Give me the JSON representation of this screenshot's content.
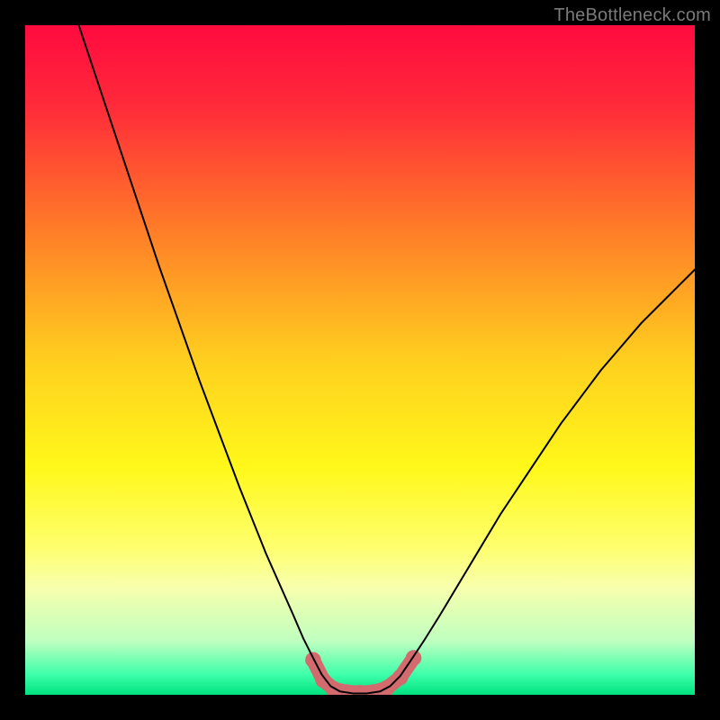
{
  "watermark": "TheBottleneck.com",
  "chart_data": {
    "type": "line",
    "title": "",
    "xlabel": "",
    "ylabel": "",
    "xlim": [
      0,
      100
    ],
    "ylim": [
      0,
      100
    ],
    "background_gradient": {
      "stops": [
        {
          "pos": 0.0,
          "color": "#ff0b3f"
        },
        {
          "pos": 0.12,
          "color": "#ff2a3a"
        },
        {
          "pos": 0.3,
          "color": "#ff7a28"
        },
        {
          "pos": 0.5,
          "color": "#ffcf1f"
        },
        {
          "pos": 0.66,
          "color": "#fff81a"
        },
        {
          "pos": 0.78,
          "color": "#feff6e"
        },
        {
          "pos": 0.84,
          "color": "#f7ffad"
        },
        {
          "pos": 0.92,
          "color": "#bfffc0"
        },
        {
          "pos": 0.97,
          "color": "#3dffa9"
        },
        {
          "pos": 1.0,
          "color": "#00e27f"
        }
      ]
    },
    "series": [
      {
        "name": "bottleneck-curve",
        "color": "#000000",
        "stroke_width": 2,
        "points": [
          {
            "x": 8.0,
            "y": 100.0
          },
          {
            "x": 11.0,
            "y": 91.0
          },
          {
            "x": 14.0,
            "y": 82.0
          },
          {
            "x": 17.0,
            "y": 73.0
          },
          {
            "x": 20.0,
            "y": 64.0
          },
          {
            "x": 23.0,
            "y": 55.5
          },
          {
            "x": 26.0,
            "y": 47.0
          },
          {
            "x": 29.0,
            "y": 39.0
          },
          {
            "x": 32.0,
            "y": 31.0
          },
          {
            "x": 34.0,
            "y": 26.0
          },
          {
            "x": 36.0,
            "y": 21.0
          },
          {
            "x": 38.0,
            "y": 16.5
          },
          {
            "x": 40.0,
            "y": 12.0
          },
          {
            "x": 41.5,
            "y": 8.5
          },
          {
            "x": 43.0,
            "y": 5.5
          },
          {
            "x": 44.3,
            "y": 3.0
          },
          {
            "x": 45.6,
            "y": 1.3
          },
          {
            "x": 47.0,
            "y": 0.5
          },
          {
            "x": 49.0,
            "y": 0.2
          },
          {
            "x": 51.0,
            "y": 0.2
          },
          {
            "x": 53.0,
            "y": 0.5
          },
          {
            "x": 54.5,
            "y": 1.3
          },
          {
            "x": 56.0,
            "y": 2.8
          },
          {
            "x": 57.5,
            "y": 5.0
          },
          {
            "x": 59.5,
            "y": 8.0
          },
          {
            "x": 62.0,
            "y": 12.0
          },
          {
            "x": 65.0,
            "y": 17.0
          },
          {
            "x": 68.0,
            "y": 22.0
          },
          {
            "x": 71.0,
            "y": 27.0
          },
          {
            "x": 74.0,
            "y": 31.5
          },
          {
            "x": 77.0,
            "y": 36.0
          },
          {
            "x": 80.0,
            "y": 40.5
          },
          {
            "x": 83.0,
            "y": 44.5
          },
          {
            "x": 86.0,
            "y": 48.5
          },
          {
            "x": 89.0,
            "y": 52.0
          },
          {
            "x": 92.0,
            "y": 55.5
          },
          {
            "x": 95.0,
            "y": 58.5
          },
          {
            "x": 98.0,
            "y": 61.5
          },
          {
            "x": 100.0,
            "y": 63.5
          }
        ]
      },
      {
        "name": "highlight-band",
        "color": "#d36a6e",
        "stroke_width": 16,
        "points": [
          {
            "x": 43.0,
            "y": 5.2
          },
          {
            "x": 44.5,
            "y": 2.2
          },
          {
            "x": 46.0,
            "y": 0.9
          },
          {
            "x": 48.0,
            "y": 0.4
          },
          {
            "x": 50.0,
            "y": 0.3
          },
          {
            "x": 52.0,
            "y": 0.4
          },
          {
            "x": 54.0,
            "y": 1.0
          },
          {
            "x": 56.0,
            "y": 2.6
          },
          {
            "x": 58.0,
            "y": 5.5
          }
        ],
        "endpoint_markers": true
      }
    ]
  }
}
